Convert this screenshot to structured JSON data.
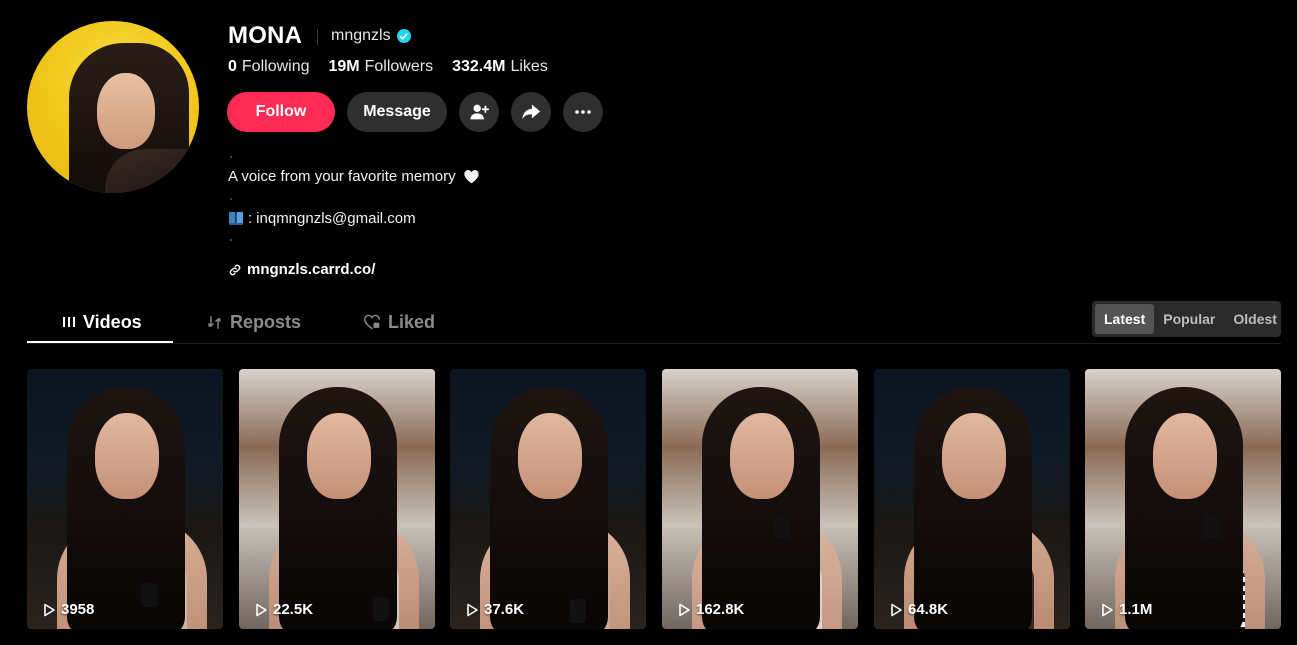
{
  "profile": {
    "display_name": "MONA",
    "username": "mngnzls",
    "verified": true,
    "stats": [
      {
        "value": "0",
        "label": "Following"
      },
      {
        "value": "19M",
        "label": "Followers"
      },
      {
        "value": "332.4M",
        "label": "Likes"
      }
    ],
    "bio": "A voice from your favorite memory",
    "email_prefix": ":",
    "email": "inqmngnzls@gmail.com",
    "link": "mngnzls.carrd.co/"
  },
  "actions": {
    "follow_label": "Follow",
    "message_label": "Message"
  },
  "tabs": [
    {
      "label": "Videos",
      "active": true,
      "icon": "grid-lines-icon"
    },
    {
      "label": "Reposts",
      "active": false,
      "icon": "repost-icon"
    },
    {
      "label": "Liked",
      "active": false,
      "icon": "heart-lock-icon"
    }
  ],
  "sort": {
    "options": [
      "Latest",
      "Popular",
      "Oldest"
    ],
    "selected": "Latest"
  },
  "videos": [
    {
      "views": "3958"
    },
    {
      "views": "22.5K"
    },
    {
      "views": "37.6K"
    },
    {
      "views": "162.8K"
    },
    {
      "views": "64.8K"
    },
    {
      "views": "1.1M"
    }
  ],
  "colors": {
    "background": "#000000",
    "follow_button": "#fe2c55",
    "secondary_button": "#2f2f2f",
    "verified_badge": "#20d5ec"
  }
}
